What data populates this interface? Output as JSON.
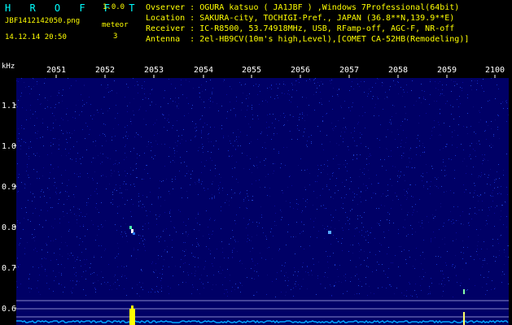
{
  "header": {
    "app_name": "H R O F F T",
    "version": "1.0.0",
    "filename": "JBF1412142050.png",
    "meteor_label": "meteor",
    "datetime": "14.12.14 20:50",
    "meteor_count": "3",
    "info_lines": [
      "Ovserver : OGURA katsuo ( JA1JBF ) ,Windows 7Professional(64bit)",
      "Location : SAKURA-city, TOCHIGI-Pref., JAPAN (36.8**N,139.9**E)",
      "Receiver : IC-R8500, 53.74918MHz, USB, RFamp-off, AGC-F, NR-off",
      "Antenna  : 2el-HB9CV(10m's high,Level),[COMET CA-52HB(Remodeling)]"
    ]
  },
  "spectrogram": {
    "y_unit": "kHz",
    "y_ticks": [
      "1.1",
      "1.0",
      "0.9",
      "0.8",
      "0.7",
      "0.6"
    ],
    "x_ticks": [
      "2051",
      "2052",
      "2053",
      "2054",
      "2055",
      "2056",
      "2057",
      "2058",
      "2059",
      "2100"
    ],
    "colors": {
      "background": "#000066",
      "axis_text": "#ffffff",
      "ref_line": "#8888cc",
      "baseline": "#00aaff",
      "meteor": "#ffff00"
    }
  }
}
